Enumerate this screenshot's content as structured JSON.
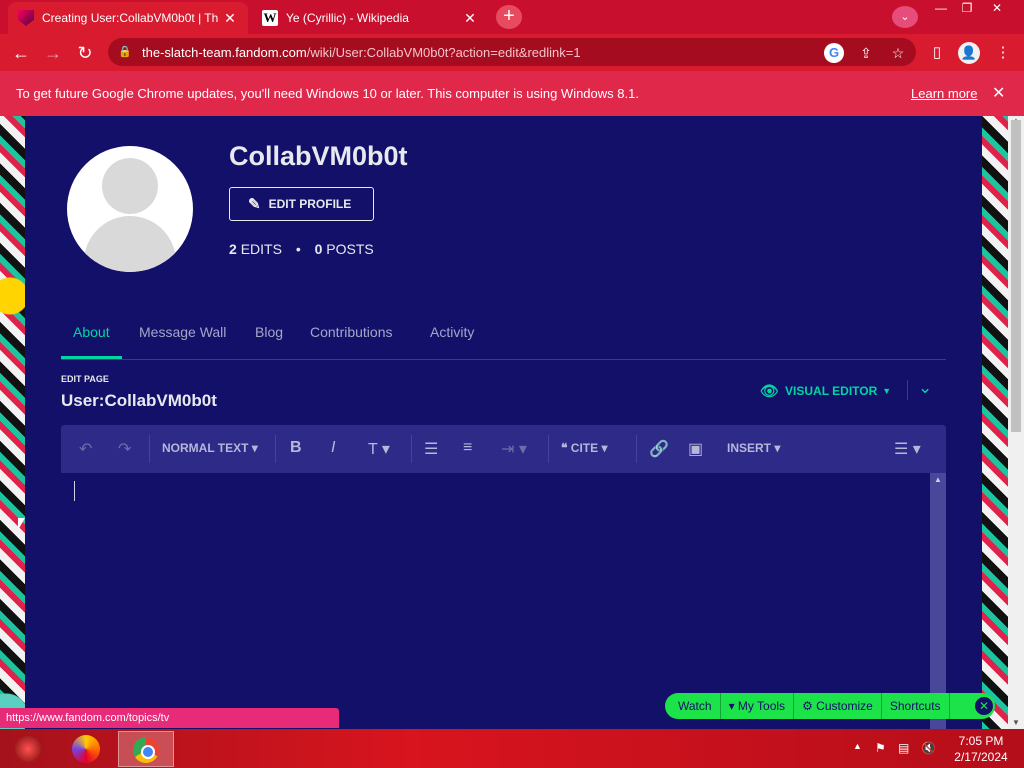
{
  "browser": {
    "tabs": [
      {
        "title": "Creating User:CollabVM0b0t | Th",
        "icon": "fandom-icon",
        "active": true
      },
      {
        "title": "Ye (Cyrillic) - Wikipedia",
        "icon": "wikipedia-icon",
        "active": false
      }
    ],
    "new_tab": "+",
    "url_host": "the-slatch-team.fandom.com",
    "url_path": "/wiki/User:CollabVM0b0t?action=edit&redlink=1",
    "infobar_message": "To get future Google Chrome updates, you'll need Windows 10 or later. This computer is using Windows 8.1.",
    "infobar_link": "Learn more",
    "status_url": "https://www.fandom.com/topics/tv"
  },
  "profile": {
    "username": "CollabVM0b0t",
    "edit_profile": "EDIT PROFILE",
    "edits_count": "2",
    "edits_label": "EDITS",
    "posts_count": "0",
    "posts_label": "POSTS"
  },
  "tabs": [
    "About",
    "Message Wall",
    "Blog",
    "Contributions",
    "Activity"
  ],
  "editor": {
    "edit_page_label": "EDIT PAGE",
    "page_name": "User:CollabVM0b0t",
    "visual_editor": "VISUAL EDITOR",
    "toolbar": {
      "normal_text": "NORMAL TEXT",
      "cite": "CITE",
      "insert": "INSERT"
    }
  },
  "fandom_toolbar": {
    "watch": "Watch",
    "my_tools": "My Tools",
    "customize": "Customize",
    "shortcuts": "Shortcuts"
  },
  "taskbar": {
    "time": "7:05 PM",
    "date": "2/17/2024"
  },
  "colors": {
    "accent": "#00d6a2",
    "page_bg": "#13106a",
    "browser_theme": "#d81b2f"
  }
}
